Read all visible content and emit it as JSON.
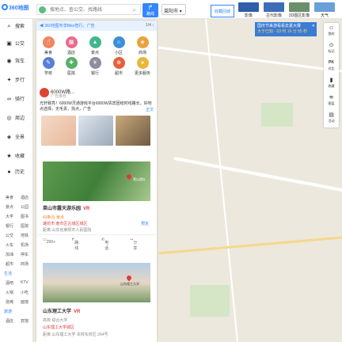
{
  "header": {
    "logo": "360地图",
    "search_placeholder": "搜地点、查公交、找路线",
    "search_icon": "magnifier-icon",
    "route_label": "路线",
    "city": "莱阳市"
  },
  "top_tools": [
    {
      "label": "收藏回城"
    },
    {
      "label": "影像"
    },
    {
      "label": "古代影像"
    },
    {
      "label": "3D图区影像"
    },
    {
      "label": "天气"
    }
  ],
  "banner": {
    "title": "国庆节来游看看去夏大赛",
    "subtitle": "大于已知 · 03 时 16 分 55 秒",
    "close": "✕"
  },
  "left_nav": [
    {
      "icon": "search-icon",
      "label": "搜索"
    },
    {
      "icon": "bus-icon",
      "label": "公交"
    },
    {
      "icon": "car-icon",
      "label": "驾车"
    },
    {
      "icon": "walk-icon",
      "label": "步行"
    },
    {
      "icon": "bike-icon",
      "label": "骑行"
    },
    {
      "icon": "around-icon",
      "label": "周边"
    },
    {
      "icon": "locate-icon",
      "label": "全景"
    },
    {
      "icon": "star-icon",
      "label": "收藏"
    },
    {
      "icon": "history-icon",
      "label": "历史"
    }
  ],
  "categories": {
    "rows": [
      [
        "美食",
        "酒店"
      ],
      [
        "景点",
        "公园"
      ],
      [
        "大学",
        "图书"
      ],
      [
        "银行",
        "医院"
      ],
      [
        "公交",
        "地铁"
      ],
      [
        "火车",
        "机场"
      ],
      [
        "加油",
        "停车"
      ],
      [
        "超市",
        "商场"
      ]
    ],
    "head1": "生活",
    "rows2": [
      [
        "酒吧",
        "KTV"
      ],
      [
        "火锅",
        "小吃"
      ],
      [
        "烧烤",
        "面馆"
      ]
    ],
    "head2": "旅游",
    "rows3": [
      [
        "酒店",
        "宾馆"
      ]
    ]
  },
  "panel": {
    "notice": "360地图专享Bike智行，广告",
    "notice_page": "1/4 ›",
    "icons": [
      {
        "label": "美食",
        "color": "#f5845c",
        "glyph": "🍴"
      },
      {
        "label": "酒店",
        "color": "#e86b8e",
        "glyph": "▦"
      },
      {
        "label": "景点",
        "color": "#3fb88a",
        "glyph": "▲"
      },
      {
        "label": "小区",
        "color": "#3d8fd8",
        "glyph": "⌂"
      },
      {
        "label": "商场",
        "color": "#e9a23b",
        "glyph": "◈"
      },
      {
        "label": "学校",
        "color": "#5b7fd6",
        "glyph": "✎"
      },
      {
        "label": "医院",
        "color": "#58b06a",
        "glyph": "✚"
      },
      {
        "label": "银行",
        "color": "#8a8fa0",
        "glyph": "¥"
      },
      {
        "label": "超市",
        "color": "#e4603c",
        "glyph": "⊕"
      },
      {
        "label": "更多服务",
        "color": "#e8b73b",
        "glyph": "●"
      }
    ],
    "ad": {
      "title": "6000W路...",
      "sub": "广告推荐",
      "text": "光轩致亮！6000W灵通游戏平台6000W贵宾团结时线路长，好地点选择，无毛贵，找点，广告",
      "link": "正文"
    },
    "results": [
      {
        "name": "莱山市露天游乐园",
        "vr": "VR",
        "meta1": "43条页 景点",
        "meta2": "潍坊市 南市区古城区城区",
        "meta3": "距离 山东省莱阳市人民医院",
        "book": "预定",
        "acts": [
          "200+",
          "路线",
          "电话",
          "分享"
        ],
        "map_label": "莱山遗址"
      },
      {
        "name": "山东理工大学",
        "vr": "VR",
        "meta1": "高校 综合大学",
        "meta2": "山东理工大学城区",
        "meta3": "距离 山东理工大学 本校东校区 264号",
        "map_label": "山东理工大学"
      }
    ]
  },
  "right_tools": [
    {
      "icon": "smile-icon",
      "label": "我的"
    },
    {
      "icon": "pin-icon",
      "label": "标记"
    },
    {
      "icon": "pk-icon",
      "label": "对比"
    },
    {
      "icon": "bookmark-icon",
      "label": "收藏"
    },
    {
      "icon": "layers-icon",
      "label": "图层"
    },
    {
      "icon": "calendar-icon",
      "label": "活动"
    }
  ]
}
